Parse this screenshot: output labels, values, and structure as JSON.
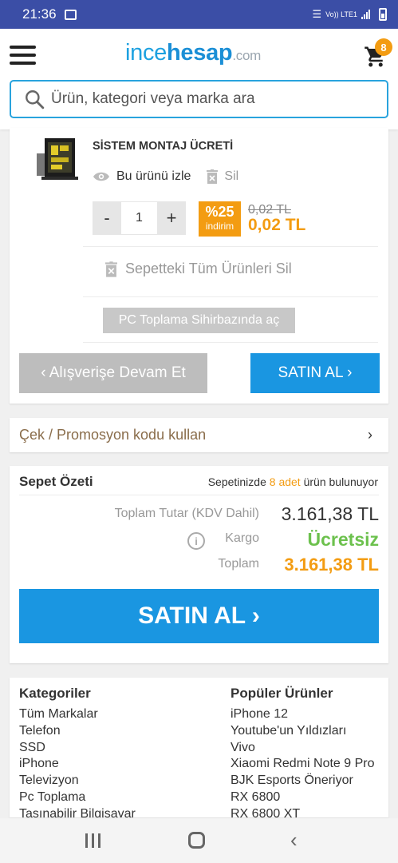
{
  "status_bar": {
    "time": "21:36",
    "network": "Vo)) LTE1"
  },
  "header": {
    "logo": {
      "part1": "ince",
      "part2": "hesap",
      "part3": ".com"
    },
    "cart_count": "8",
    "search": {
      "placeholder": "Ürün, kategori veya marka ara"
    }
  },
  "cart_item": {
    "name": "SİSTEM MONTAJ ÜCRETİ",
    "watch_label": "Bu ürünü izle",
    "delete_label": "Sil",
    "quantity": "1",
    "minus": "-",
    "plus": "+",
    "discount_percent": "%25",
    "discount_label": "indirim",
    "old_price": "0,02 TL",
    "new_price": "0,02 TL"
  },
  "cart_actions": {
    "delete_all_label": "Sepetteki Tüm Ürünleri Sil",
    "wizard_label": "PC Toplama Sihirbazında aç",
    "continue_label": "‹ Alışverişe Devam Et",
    "buy_label": "SATIN AL ›"
  },
  "promo": {
    "label": "Çek / Promosyon kodu kullan",
    "chevron": "›"
  },
  "summary": {
    "title": "Sepet Özeti",
    "count_prefix": "Sepetinizde ",
    "count": "8 adet",
    "count_suffix": " ürün bulunuyor",
    "total_label": "Toplam Tutar (KDV Dahil)",
    "total_value": "3.161,38 TL",
    "shipping_label": "Kargo",
    "shipping_value": "Ücretsiz",
    "grand_label": "Toplam",
    "grand_value": "3.161,38 TL",
    "buy_label": "SATIN AL ›"
  },
  "footer": {
    "categories": {
      "title": "Kategoriler",
      "items": [
        "Tüm Markalar",
        "Telefon",
        "SSD",
        "iPhone",
        "Televizyon",
        "Pc Toplama",
        "Taşınabilir Bilgisayar"
      ]
    },
    "popular": {
      "title": "Popüler Ürünler",
      "items": [
        "iPhone 12",
        "Youtube'un Yıldızları",
        "Vivo",
        "Xiaomi Redmi Note 9 Pro",
        "BJK Esports Öneriyor",
        "RX 6800",
        "RX 6800 XT"
      ]
    }
  },
  "colors": {
    "accent_blue": "#1a96e1",
    "orange": "#f39c12",
    "green": "#6cc14d",
    "status_bar": "#3b4ea6"
  }
}
